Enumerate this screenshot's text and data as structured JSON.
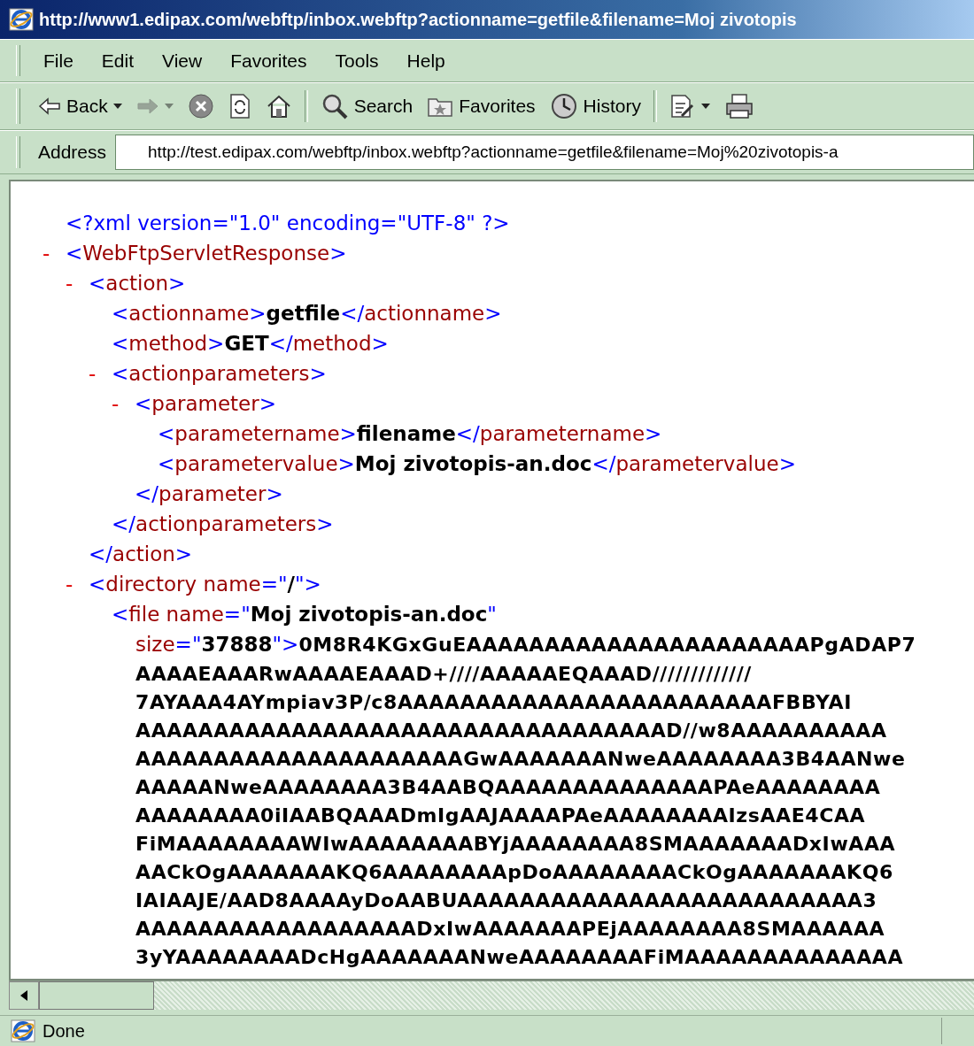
{
  "window": {
    "title": "http://www1.edipax.com/webftp/inbox.webftp?actionname=getfile&filename=Moj zivotopis"
  },
  "menu": [
    "File",
    "Edit",
    "View",
    "Favorites",
    "Tools",
    "Help"
  ],
  "toolbar": [
    {
      "kind": "back",
      "label": "Back",
      "dropdown": true,
      "disabled": false
    },
    {
      "kind": "forward",
      "dropdown": true,
      "disabled": true
    },
    {
      "kind": "stop",
      "disabled": false
    },
    {
      "kind": "refresh",
      "disabled": false
    },
    {
      "kind": "home",
      "disabled": false
    },
    {
      "kind": "separator"
    },
    {
      "kind": "search",
      "label": "Search",
      "disabled": false
    },
    {
      "kind": "favorites",
      "label": "Favorites",
      "disabled": false
    },
    {
      "kind": "history",
      "label": "History",
      "disabled": false
    },
    {
      "kind": "separator"
    },
    {
      "kind": "edit",
      "dropdown": true,
      "disabled": false
    },
    {
      "kind": "print",
      "disabled": false
    }
  ],
  "address": {
    "label": "Address",
    "value": "http://test.edipax.com/webftp/inbox.webftp?actionname=getfile&filename=Moj%20zivotopis-a"
  },
  "document": [
    {
      "kind": "declaration",
      "text": "<?xml version=\"1.0\" encoding=\"UTF-8\" ?>"
    },
    {
      "kind": "element",
      "toggle": "-",
      "open_tag": "<WebFtpServletResponse>",
      "children": [
        {
          "kind": "element",
          "toggle": "-",
          "open_tag": "<action>",
          "close_tag": "</action>",
          "children": [
            {
              "kind": "leaf",
              "open_tag": "<actionname>",
              "text": "getfile",
              "close_tag": "</actionname>"
            },
            {
              "kind": "leaf",
              "open_tag": "<method>",
              "text": "GET",
              "close_tag": "</method>"
            },
            {
              "kind": "element",
              "toggle": "-",
              "open_tag": "<actionparameters>",
              "close_tag": "</actionparameters>",
              "children": [
                {
                  "kind": "element",
                  "toggle": "-",
                  "open_tag": "<parameter>",
                  "close_tag": "</parameter>",
                  "children": [
                    {
                      "kind": "leaf",
                      "open_tag": "<parametername>",
                      "text": "filename",
                      "close_tag": "</parametername>"
                    },
                    {
                      "kind": "leaf",
                      "open_tag": "<parametervalue>",
                      "text": "Moj zivotopis-an.doc",
                      "close_tag": "</parametervalue>"
                    }
                  ]
                }
              ]
            }
          ]
        },
        {
          "kind": "element",
          "toggle": "-",
          "open_tag": "<directory name=\"/\">",
          "children": [
            {
              "kind": "content",
              "tag_lines": [
                "<file name=\"Moj zivotopis-an.doc\"",
                "size=\"37888\">"
              ],
              "text_lines": [
                "0M8R4KGxGuEAAAAAAAAAAAAAAAAAAAAAAPgADAP7",
                "AAAAEAAARwAAAAEAAAD+////AAAAAEQAAAD/////////////",
                "7AYAAA4AYmpiav3P/c8AAAAAAAAAAAAAAAAAAAAAAAAFBBYAI",
                "AAAAAAAAAAAAAAAAAAAAAAAAAAAAAAAAAAD//w8AAAAAAAAAA",
                "AAAAAAAAAAAAAAAAAAAAAGwAAAAAAANweAAAAAAAA3B4AANwe",
                "AAAAANweAAAAAAAA3B4AABQAAAAAAAAAAAAAAPAeAAAAAAAA",
                "AAAAAAAA0iIAABQAAADmIgAAJAAAAPAeAAAAAAAAIzsAAE4CAA",
                "FiMAAAAAAAAWIwAAAAAAAABYjAAAAAAAA8SMAAAAAAADxIwAAA",
                "AACkOgAAAAAAAKQ6AAAAAAAApDoAAAAAAAACkOgAAAAAAAKQ6",
                "IAIAAJE/AAD8AAAAyDoAABUAAAAAAAAAAAAAAAAAAAAAAAAAA3",
                "AAAAAAAAAAAAAAAAAADxIwAAAAAAAPEjAAAAAAAA8SMAAAAAA",
                "3yYAAAAAAAADcHgAAAAAAANweAAAAAAAAFiMAAAAAAAAAAAAAA"
              ]
            }
          ]
        }
      ]
    }
  ],
  "status_bar": {
    "text": "Done"
  }
}
